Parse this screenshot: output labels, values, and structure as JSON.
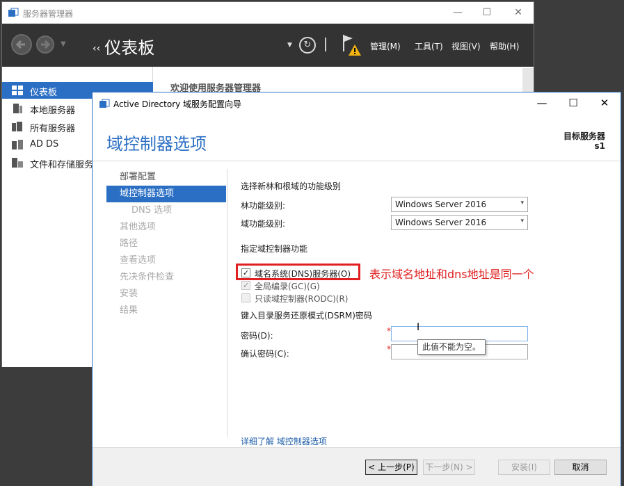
{
  "server_manager": {
    "title": "服务器管理器",
    "breadcrumb_arrows": "‹‹",
    "breadcrumb": "仪表板",
    "menu": [
      "管理(M)",
      "工具(T)",
      "视图(V)",
      "帮助(H)"
    ],
    "nav": [
      "仪表板",
      "本地服务器",
      "所有服务器",
      "AD DS",
      "文件和存储服务"
    ],
    "welcome": "欢迎使用服务器管理器"
  },
  "wizard": {
    "title": "Active Directory 域服务配置向导",
    "heading": "域控制器选项",
    "target_label": "目标服务器",
    "target_value": "s1",
    "steps": [
      {
        "label": "部署配置",
        "state": "done"
      },
      {
        "label": "域控制器选项",
        "state": "active"
      },
      {
        "label": "DNS 选项",
        "state": "disabled"
      },
      {
        "label": "其他选项",
        "state": "disabled"
      },
      {
        "label": "路径",
        "state": "disabled"
      },
      {
        "label": "查看选项",
        "state": "disabled"
      },
      {
        "label": "先决条件检查",
        "state": "disabled"
      },
      {
        "label": "安装",
        "state": "disabled"
      },
      {
        "label": "结果",
        "state": "disabled"
      }
    ],
    "functional_level_heading": "选择新林和根域的功能级别",
    "forest_level_label": "林功能级别:",
    "forest_level_value": "Windows Server 2016",
    "domain_level_label": "域功能级别:",
    "domain_level_value": "Windows Server 2016",
    "capabilities_heading": "指定域控制器功能",
    "dns_checkbox": {
      "label": "域名系统(DNS)服务器(O)",
      "checked": true
    },
    "gc_checkbox": {
      "label": "全局编录(GC)(G)",
      "checked": true
    },
    "rodc_checkbox": {
      "label": "只读域控制器(RODC)(R)",
      "checked": false
    },
    "annotation": "表示域名地址和dns地址是同一个",
    "dsrm_heading": "键入目录服务还原模式(DSRM)密码",
    "password_label": "密码(D):",
    "confirm_label": "确认密码(C):",
    "required_marker": "*",
    "tooltip": "此值不能为空。",
    "more_link": "详细了解 域控制器选项",
    "buttons": {
      "prev": "< 上一步(P)",
      "next": "下一步(N) >",
      "install": "安装(I)",
      "cancel": "取消"
    }
  },
  "colors": {
    "accent": "#2b6fc4",
    "annotation": "#e02020",
    "header_bg": "#333333"
  }
}
